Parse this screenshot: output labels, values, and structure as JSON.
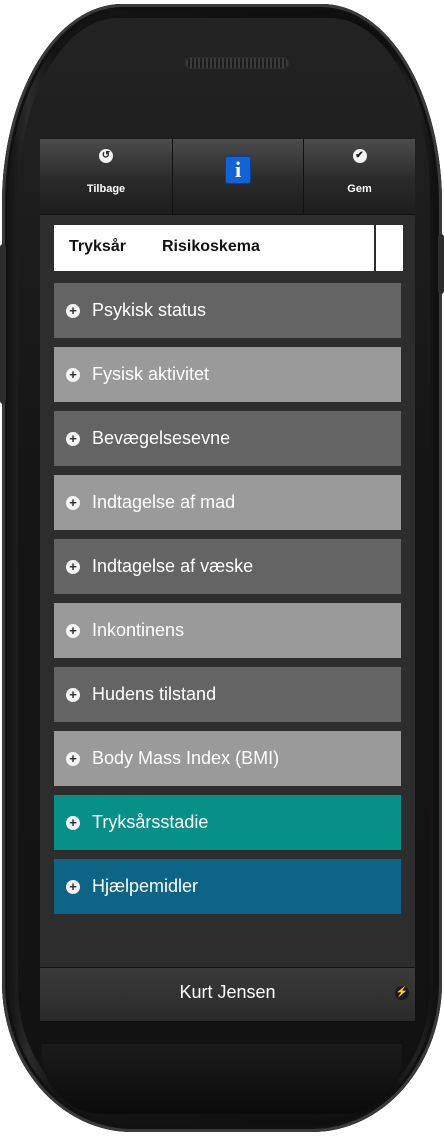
{
  "toolbar": {
    "back_label": "Tilbage",
    "save_label": "Gem"
  },
  "header": {
    "title": "Tryksår",
    "subtitle": "Risikoskema"
  },
  "sections": [
    {
      "label": "Psykisk status"
    },
    {
      "label": "Fysisk aktivitet"
    },
    {
      "label": "Bevægelsesevne"
    },
    {
      "label": "Indtagelse af mad"
    },
    {
      "label": "Indtagelse af væske"
    },
    {
      "label": "Inkontinens"
    },
    {
      "label": "Hudens tilstand"
    },
    {
      "label": "Body Mass Index (BMI)"
    },
    {
      "label": "Tryksårsstadie"
    },
    {
      "label": "Hjælpemidler"
    }
  ],
  "footer": {
    "patient_name": "Kurt Jensen"
  },
  "colors": {
    "row_dark": "#646464",
    "row_light": "#9a9a9a",
    "row_teal": "#079088",
    "row_blue": "#0c6486",
    "info_blue": "#1463d6"
  }
}
